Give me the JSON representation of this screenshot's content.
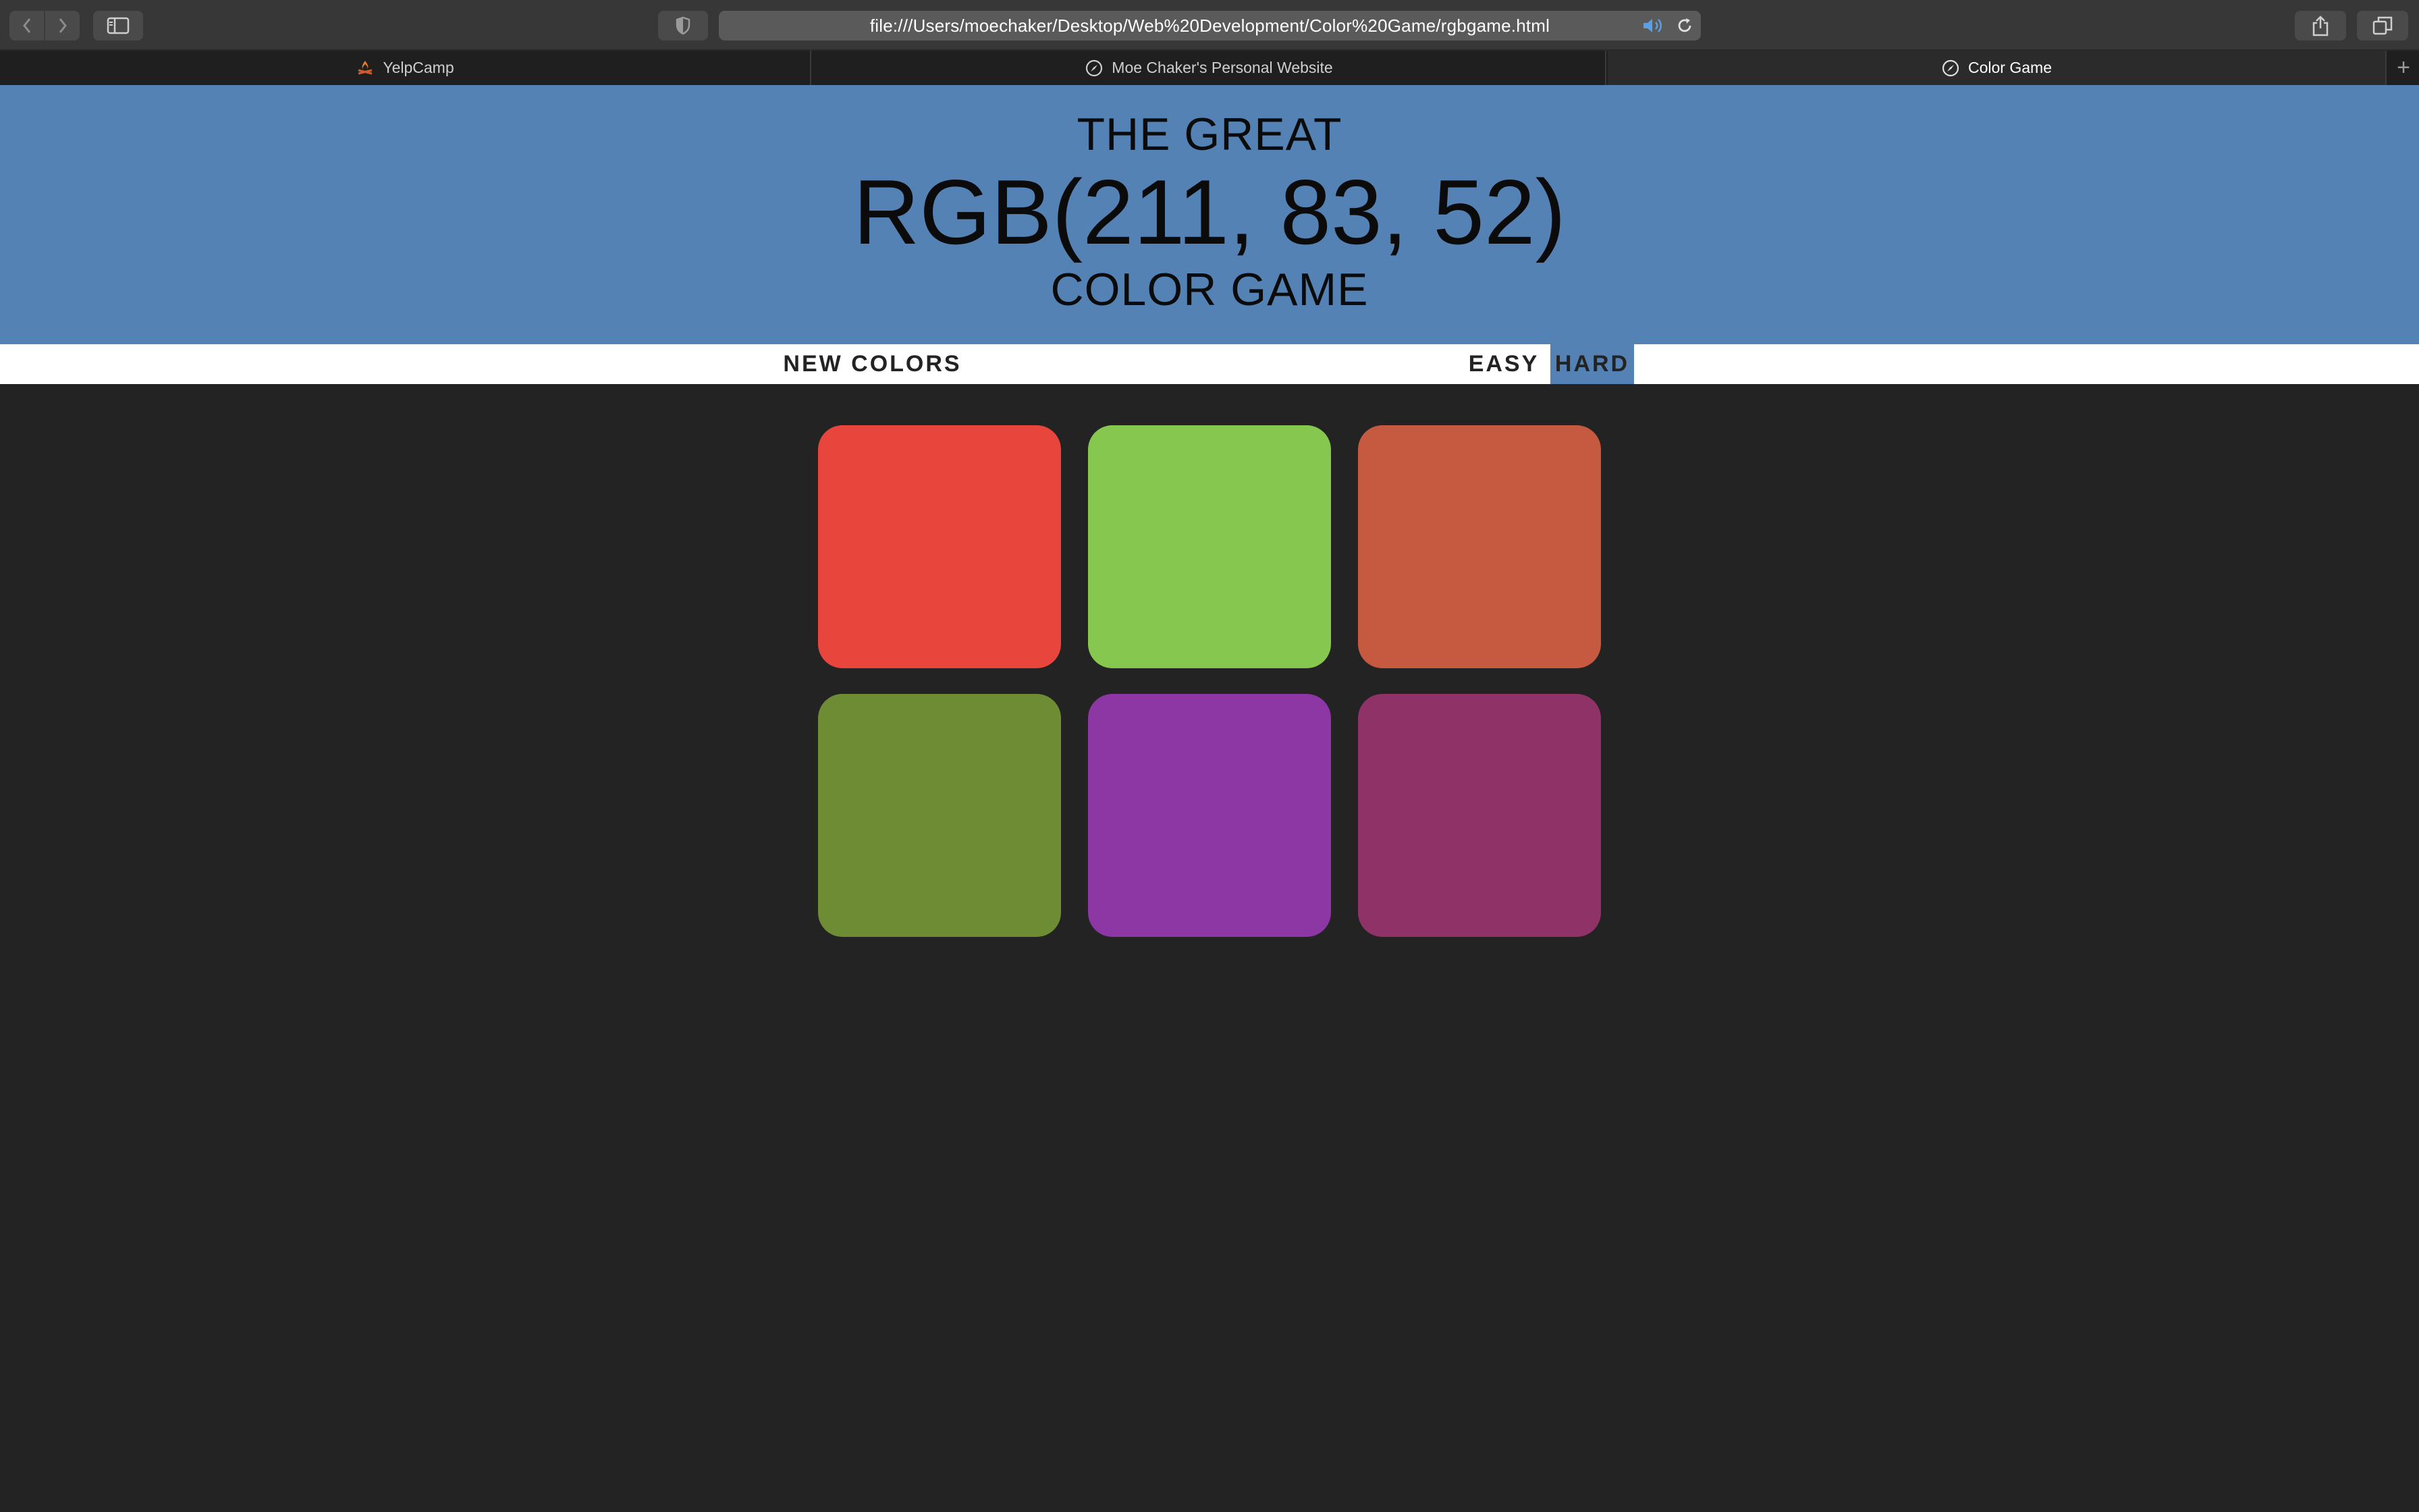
{
  "browser": {
    "url": "file:///Users/moechaker/Desktop/Web%20Development/Color%20Game/rgbgame.html",
    "tabs": [
      {
        "label": "YelpCamp",
        "icon": "campfire-icon"
      },
      {
        "label": "Moe Chaker's Personal Website",
        "icon": "compass-icon"
      },
      {
        "label": "Color Game",
        "icon": "compass-icon",
        "active": true
      }
    ],
    "new_tab_label": "+"
  },
  "header": {
    "line1": "THE GREAT",
    "rgb_display": "RGB(211, 83, 52)",
    "line3": "COLOR GAME",
    "background": "#5482b4"
  },
  "controls": {
    "new_colors_label": "NEW COLORS",
    "easy_label": "EASY",
    "hard_label": "HARD",
    "selected_mode": "HARD"
  },
  "squares": [
    {
      "color": "#e8453c"
    },
    {
      "color": "#86c84f"
    },
    {
      "color": "#c55a40"
    },
    {
      "color": "#6e8c33"
    },
    {
      "color": "#8c37a4"
    },
    {
      "color": "#8e3267"
    }
  ],
  "page_background": "#232323"
}
